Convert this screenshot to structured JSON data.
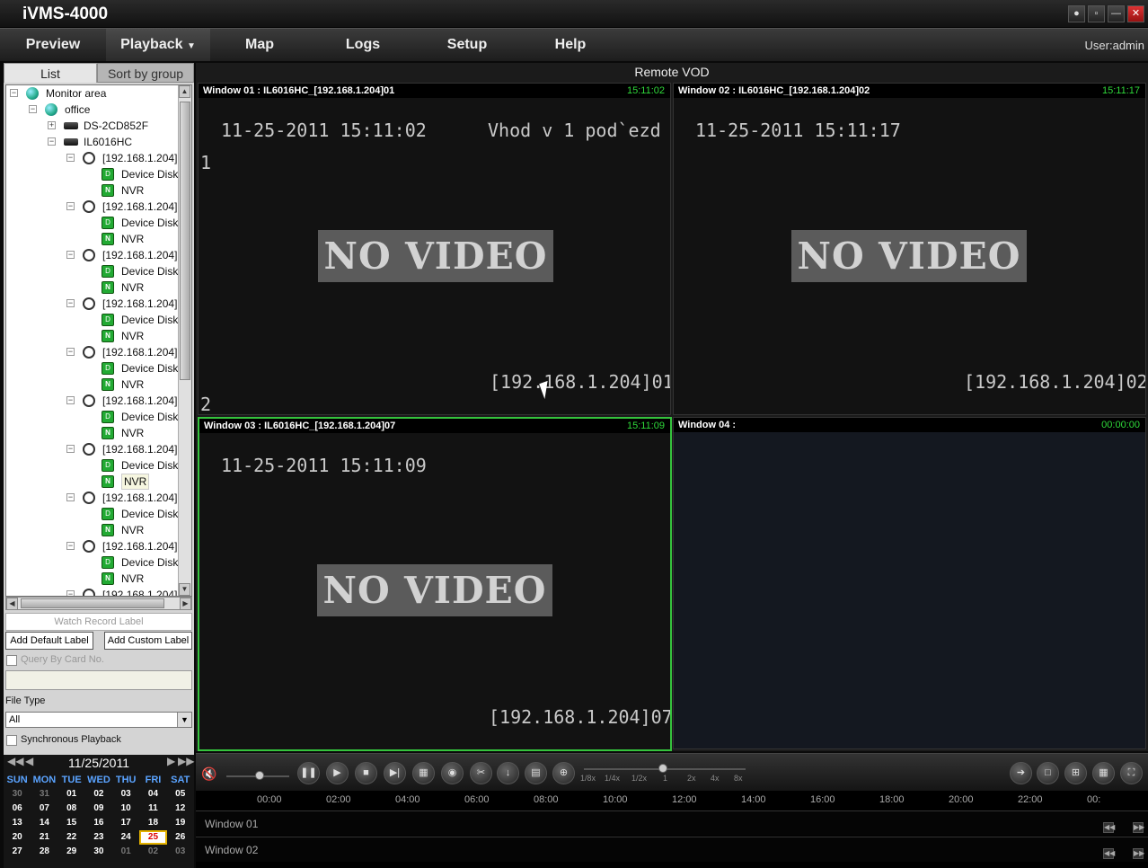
{
  "app": {
    "title": "iVMS-4000"
  },
  "menu": {
    "items": [
      "Preview",
      "Playback",
      "Map",
      "Logs",
      "Setup",
      "Help"
    ],
    "active": "Playback",
    "user": "User:admin"
  },
  "sidebar": {
    "tabs": [
      "List",
      "Sort by group"
    ],
    "tree": [
      {
        "label": "Monitor area",
        "icon": "globe-icon",
        "level": 0,
        "expand": "−"
      },
      {
        "label": "office",
        "icon": "globe-icon",
        "level": 1,
        "expand": "−"
      },
      {
        "label": "DS-2CD852F",
        "icon": "dvr-icon",
        "level": 2,
        "expand": "+"
      },
      {
        "label": "IL6016HC",
        "icon": "dvr-icon",
        "level": 2,
        "expand": "−"
      },
      {
        "label": "[192.168.1.204]",
        "icon": "camera-icon",
        "level": 3,
        "expand": "−"
      },
      {
        "label": "Device Disk",
        "icon": "disk-icon",
        "level": 4
      },
      {
        "label": "NVR",
        "icon": "nvr-icon",
        "level": 4
      },
      {
        "label": "[192.168.1.204]",
        "icon": "camera-icon",
        "level": 3,
        "expand": "−"
      },
      {
        "label": "Device Disk",
        "icon": "disk-icon",
        "level": 4
      },
      {
        "label": "NVR",
        "icon": "nvr-icon",
        "level": 4
      },
      {
        "label": "[192.168.1.204]",
        "icon": "camera-icon",
        "level": 3,
        "expand": "−"
      },
      {
        "label": "Device Disk",
        "icon": "disk-icon",
        "level": 4
      },
      {
        "label": "NVR",
        "icon": "nvr-icon",
        "level": 4
      },
      {
        "label": "[192.168.1.204]",
        "icon": "camera-icon",
        "level": 3,
        "expand": "−"
      },
      {
        "label": "Device Disk",
        "icon": "disk-icon",
        "level": 4
      },
      {
        "label": "NVR",
        "icon": "nvr-icon",
        "level": 4
      },
      {
        "label": "[192.168.1.204]",
        "icon": "camera-icon",
        "level": 3,
        "expand": "−"
      },
      {
        "label": "Device Disk",
        "icon": "disk-icon",
        "level": 4
      },
      {
        "label": "NVR",
        "icon": "nvr-icon",
        "level": 4
      },
      {
        "label": "[192.168.1.204]",
        "icon": "camera-icon",
        "level": 3,
        "expand": "−"
      },
      {
        "label": "Device Disk",
        "icon": "disk-icon",
        "level": 4
      },
      {
        "label": "NVR",
        "icon": "nvr-icon",
        "level": 4
      },
      {
        "label": "[192.168.1.204]",
        "icon": "camera-icon",
        "level": 3,
        "expand": "−"
      },
      {
        "label": "Device Disk",
        "icon": "disk-icon",
        "level": 4
      },
      {
        "label": "NVR",
        "icon": "nvr-icon",
        "level": 4,
        "selected": true
      },
      {
        "label": "[192.168.1.204]",
        "icon": "camera-icon",
        "level": 3,
        "expand": "−"
      },
      {
        "label": "Device Disk",
        "icon": "disk-icon",
        "level": 4
      },
      {
        "label": "NVR",
        "icon": "nvr-icon",
        "level": 4
      },
      {
        "label": "[192.168.1.204]",
        "icon": "camera-icon",
        "level": 3,
        "expand": "−"
      },
      {
        "label": "Device Disk",
        "icon": "disk-icon",
        "level": 4
      },
      {
        "label": "NVR",
        "icon": "nvr-icon",
        "level": 4
      },
      {
        "label": "[192.168.1.204]",
        "icon": "camera-icon",
        "level": 3,
        "expand": "−"
      }
    ],
    "watch_label": "Watch Record Label",
    "add_default_label": "Add Default Label",
    "add_custom_label": "Add Custom Label",
    "query_card": "Query By Card No.",
    "file_type_label": "File Type",
    "file_type_value": "All",
    "sync_playback": "Synchronous Playback"
  },
  "calendar": {
    "month": "11/25/2011",
    "days": [
      "SUN",
      "MON",
      "TUE",
      "WED",
      "THU",
      "FRI",
      "SAT"
    ],
    "weeks": [
      [
        "30",
        "31",
        "01",
        "02",
        "03",
        "04",
        "05"
      ],
      [
        "06",
        "07",
        "08",
        "09",
        "10",
        "11",
        "12"
      ],
      [
        "13",
        "14",
        "15",
        "16",
        "17",
        "18",
        "19"
      ],
      [
        "20",
        "21",
        "22",
        "23",
        "24",
        "25",
        "26"
      ],
      [
        "27",
        "28",
        "29",
        "30",
        "01",
        "02",
        "03"
      ]
    ],
    "today": "25"
  },
  "video": {
    "title": "Remote VOD",
    "windows": [
      {
        "label": "Window 01 : IL6016HC_[192.168.1.204]01",
        "time": "15:11:02",
        "datetime": "11-25-2011 15:11:02",
        "caption": "Vhod v 1 pod`ezd",
        "channel": "[192.168.1.204]01",
        "no_video": "NO VIDEO",
        "num1": "1",
        "num2": "2"
      },
      {
        "label": "Window 02 : IL6016HC_[192.168.1.204]02",
        "time": "15:11:17",
        "datetime": "11-25-2011 15:11:17",
        "channel": "[192.168.1.204]02",
        "no_video": "NO VIDEO"
      },
      {
        "label": "Window 03 : IL6016HC_[192.168.1.204]07",
        "time": "15:11:09",
        "datetime": "11-25-2011 15:11:09",
        "channel": "[192.168.1.204]07",
        "no_video": "NO VIDEO"
      },
      {
        "label": "Window 04 :",
        "time": "00:00:00"
      }
    ]
  },
  "controls": {
    "speeds": [
      "1/8x",
      "1/4x",
      "1/2x",
      "1",
      "2x",
      "4x",
      "8x"
    ]
  },
  "timeline": {
    "hours": [
      "00:00",
      "02:00",
      "04:00",
      "06:00",
      "08:00",
      "10:00",
      "12:00",
      "14:00",
      "16:00",
      "18:00",
      "20:00",
      "22:00",
      "00:"
    ],
    "rows": [
      "Window 01",
      "Window 02"
    ]
  }
}
